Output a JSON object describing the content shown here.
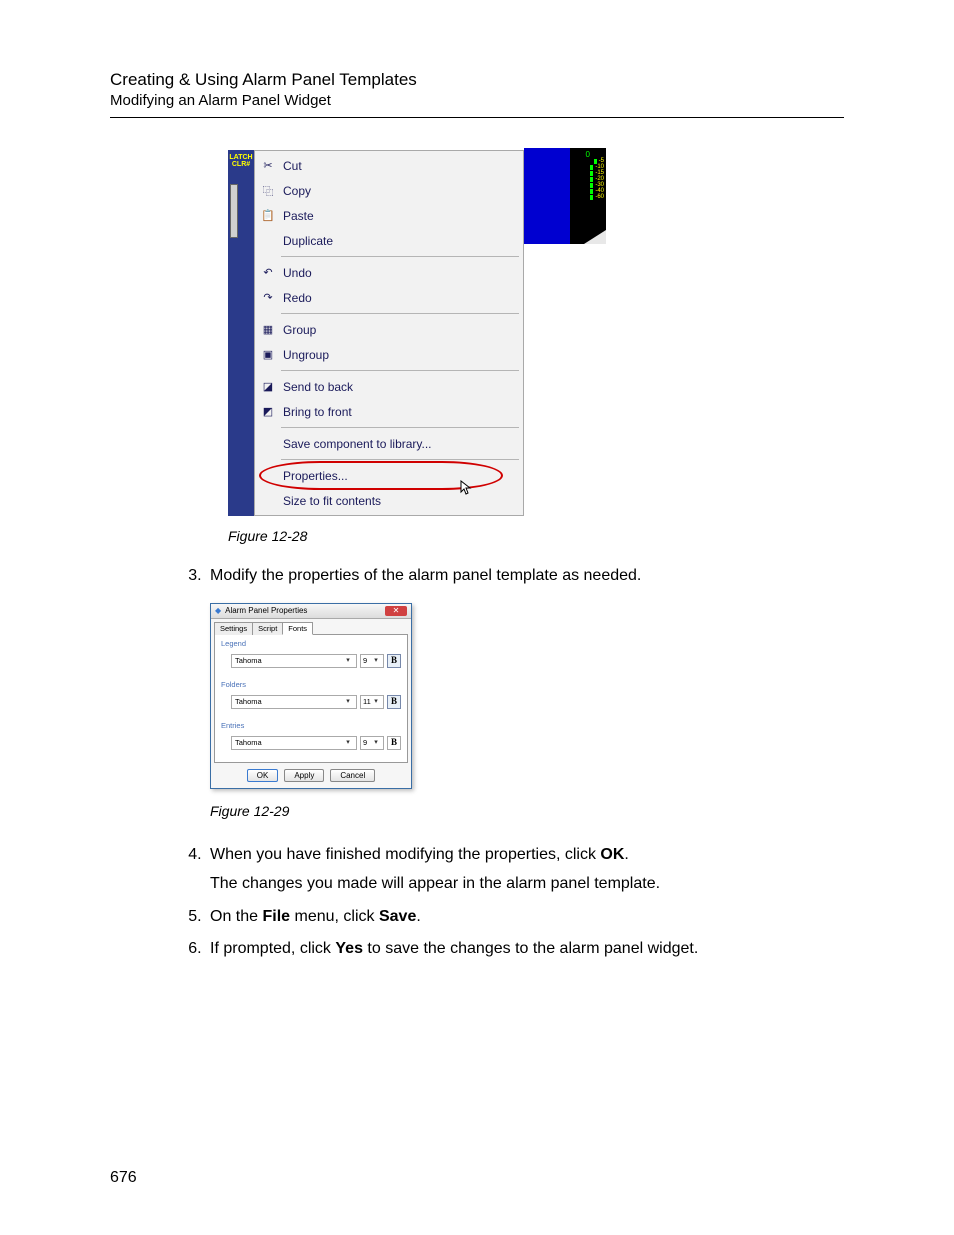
{
  "header": {
    "title": "Creating & Using Alarm Panel Templates",
    "subtitle": "Modifying an Alarm Panel Widget"
  },
  "fig28": {
    "caption": "Figure 12-28",
    "left_label_line1": "LATCH",
    "left_label_line2": "CLR#",
    "menu": {
      "cut": "Cut",
      "copy": "Copy",
      "paste": "Paste",
      "duplicate": "Duplicate",
      "undo": "Undo",
      "redo": "Redo",
      "group": "Group",
      "ungroup": "Ungroup",
      "send_to_back": "Send to back",
      "bring_to_front": "Bring to front",
      "save_component": "Save component to library...",
      "properties": "Properties...",
      "size_to_fit": "Size to fit contents"
    },
    "scale": {
      "zero": "0",
      "t1": "-5",
      "t2": "-10",
      "t3": "-15",
      "t4": "-20",
      "t5": "-30",
      "t6": "-40",
      "t7": "-60"
    }
  },
  "steps": {
    "s3": "Modify the properties of the alarm panel template as needed.",
    "s4a": "When you have finished modifying the properties, click ",
    "s4b": "OK",
    "s4c": ".",
    "s4d": "The changes you made will appear in the alarm panel template.",
    "s5a": "On the ",
    "s5b": "File",
    "s5c": " menu, click ",
    "s5d": "Save",
    "s5e": ".",
    "s6a": "If prompted, click ",
    "s6b": "Yes",
    "s6c": " to save the changes to the alarm panel widget."
  },
  "fig29": {
    "caption": "Figure 12-29",
    "title": "Alarm Panel Properties",
    "tabs": {
      "settings": "Settings",
      "script": "Script",
      "fonts": "Fonts"
    },
    "sections": {
      "legend": {
        "label": "Legend",
        "font": "Tahoma",
        "size": "9",
        "bold_on": true
      },
      "folders": {
        "label": "Folders",
        "font": "Tahoma",
        "size": "11",
        "bold_on": true
      },
      "entries": {
        "label": "Entries",
        "font": "Tahoma",
        "size": "9",
        "bold_on": false
      }
    },
    "buttons": {
      "ok": "OK",
      "apply": "Apply",
      "cancel": "Cancel"
    },
    "bold_glyph": "B"
  },
  "page_number": "676"
}
